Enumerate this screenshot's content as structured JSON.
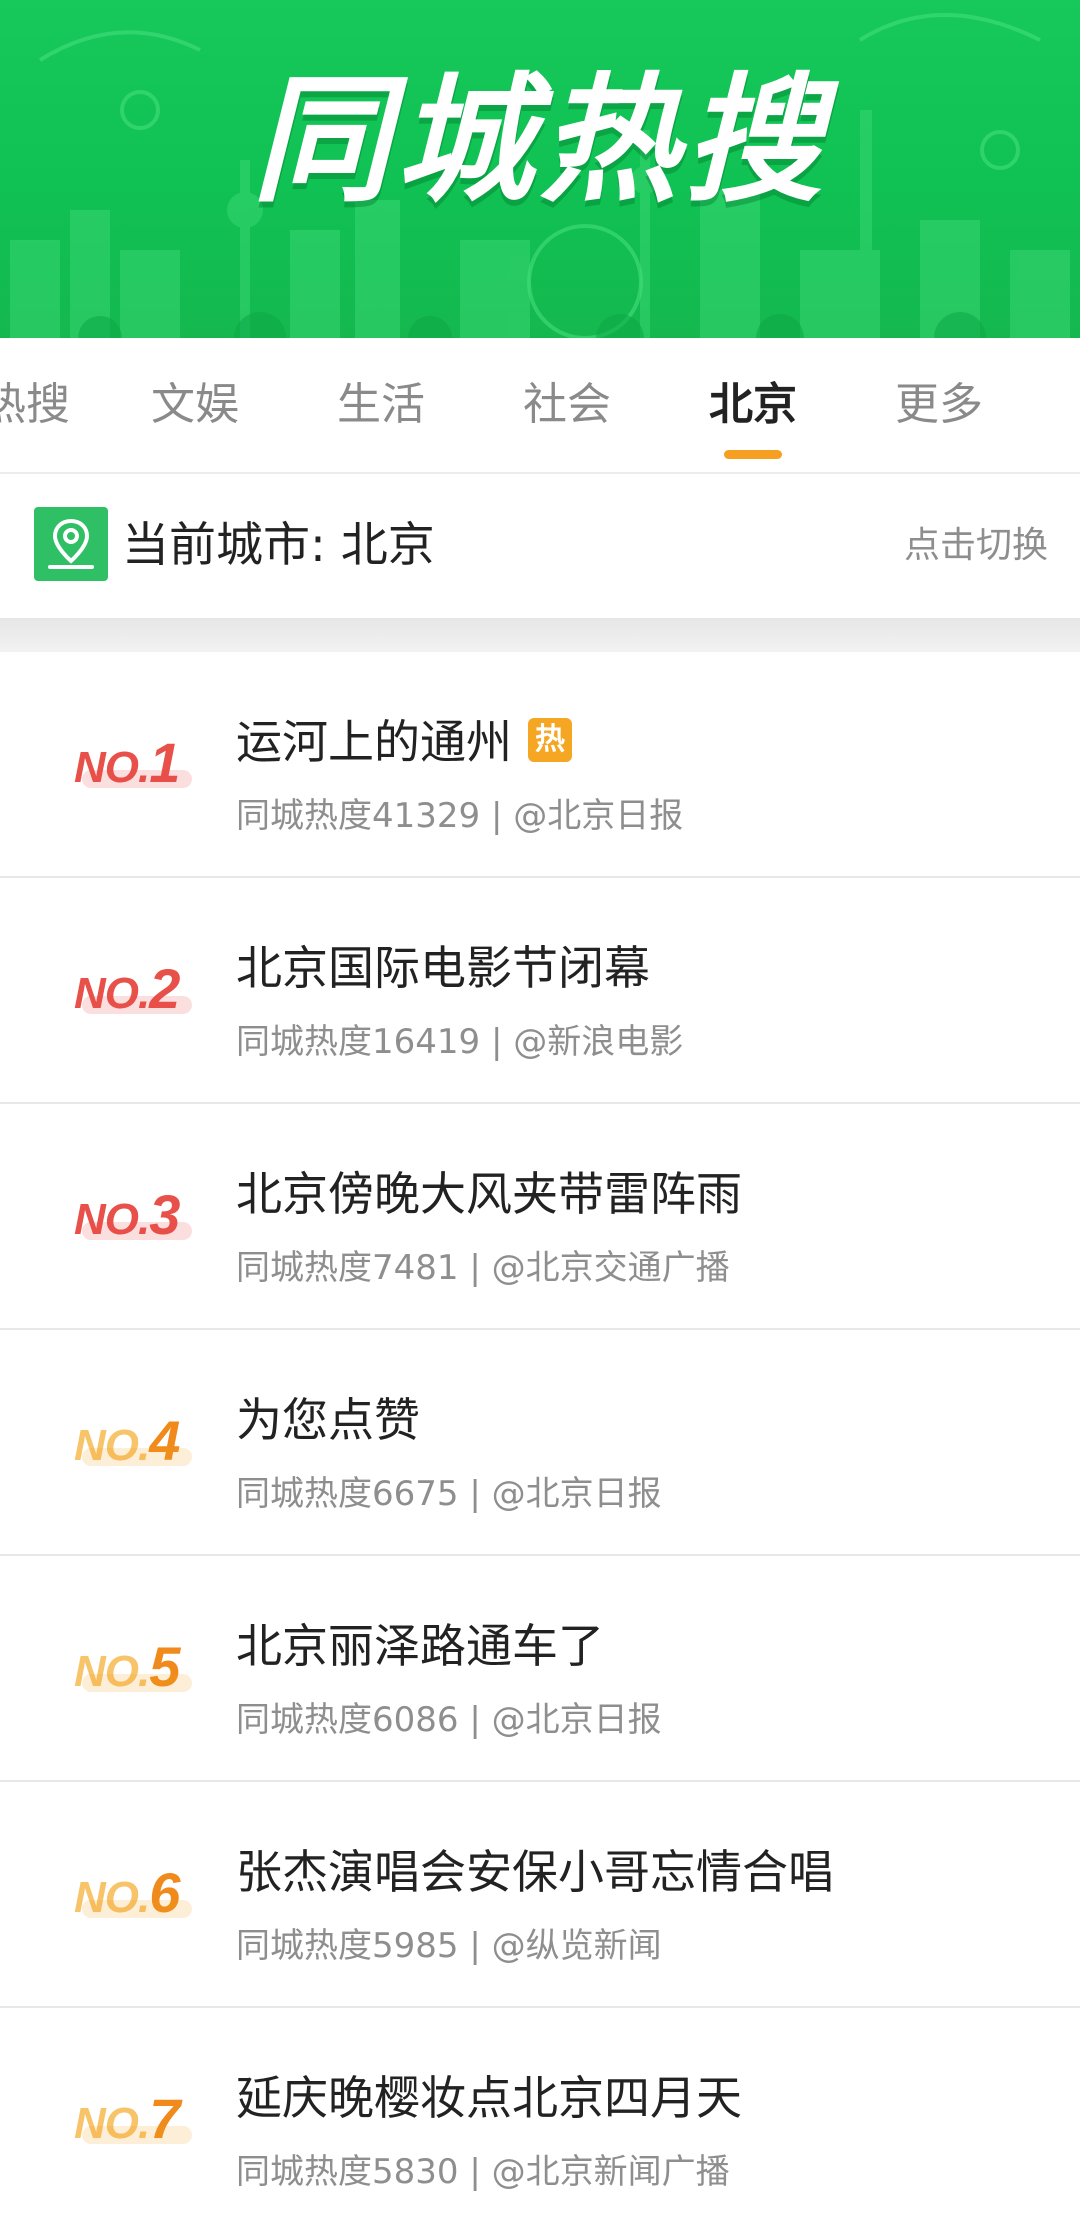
{
  "banner": {
    "title": "同城热搜"
  },
  "tabs": [
    {
      "label": "热搜",
      "active": false
    },
    {
      "label": "文娱",
      "active": false
    },
    {
      "label": "生活",
      "active": false
    },
    {
      "label": "社会",
      "active": false
    },
    {
      "label": "北京",
      "active": true
    },
    {
      "label": "更多",
      "active": false
    }
  ],
  "city": {
    "label": "当前城市: 北京",
    "switch_label": "点击切换",
    "icon": "map-pin-icon"
  },
  "list": [
    {
      "rank_prefix": "NO.",
      "rank": "1",
      "title": "运河上的通州",
      "badge": "热",
      "meta": "同城热度41329 | @北京日报",
      "rank_color": "#e8504a"
    },
    {
      "rank_prefix": "NO.",
      "rank": "2",
      "title": "北京国际电影节闭幕",
      "badge": "",
      "meta": "同城热度16419 | @新浪电影",
      "rank_color": "#e8504a"
    },
    {
      "rank_prefix": "NO.",
      "rank": "3",
      "title": "北京傍晚大风夹带雷阵雨",
      "badge": "",
      "meta": "同城热度7481 | @北京交通广播",
      "rank_color": "#e8504a"
    },
    {
      "rank_prefix": "NO.",
      "rank": "4",
      "title": "为您点赞",
      "badge": "",
      "meta": "同城热度6675 | @北京日报",
      "rank_color": "#f08a1c"
    },
    {
      "rank_prefix": "NO.",
      "rank": "5",
      "title": "北京丽泽路通车了",
      "badge": "",
      "meta": "同城热度6086 | @北京日报",
      "rank_color": "#f08a1c"
    },
    {
      "rank_prefix": "NO.",
      "rank": "6",
      "title": "张杰演唱会安保小哥忘情合唱",
      "badge": "",
      "meta": "同城热度5985 | @纵览新闻",
      "rank_color": "#f08a1c"
    },
    {
      "rank_prefix": "NO.",
      "rank": "7",
      "title": "延庆晚樱妆点北京四月天",
      "badge": "",
      "meta": "同城热度5830 | @北京新闻广播",
      "rank_color": "#f08a1c"
    }
  ],
  "colors": {
    "brand_green": "#10c153",
    "tab_indicator": "#f5a020",
    "hot_badge": "#f5a623"
  }
}
